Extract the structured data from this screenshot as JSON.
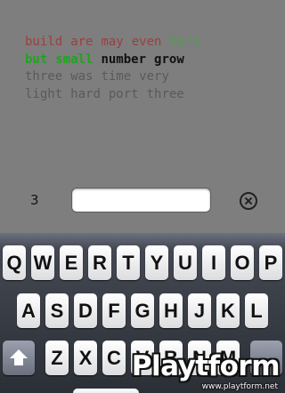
{
  "words": {
    "line1": [
      {
        "text": "build",
        "state": "done"
      },
      {
        "text": "are",
        "state": "done"
      },
      {
        "text": "may",
        "state": "done"
      },
      {
        "text": "even",
        "state": "done"
      },
      {
        "text": "turn",
        "state": "next"
      }
    ],
    "line2": [
      {
        "text": "but",
        "state": "active"
      },
      {
        "text": "small",
        "state": "active"
      },
      {
        "text": "number",
        "state": "queued"
      },
      {
        "text": "grow",
        "state": "queued"
      }
    ],
    "line3": [
      {
        "text": "three",
        "state": "future"
      },
      {
        "text": "was",
        "state": "future"
      },
      {
        "text": "time",
        "state": "future"
      },
      {
        "text": "very",
        "state": "future"
      }
    ],
    "line4": [
      {
        "text": "light",
        "state": "future"
      },
      {
        "text": "hard",
        "state": "future"
      },
      {
        "text": "port",
        "state": "future"
      },
      {
        "text": "three",
        "state": "future"
      }
    ]
  },
  "input_bar": {
    "counter": "3",
    "entry_value": "",
    "clear_icon": "clear-circle-icon"
  },
  "keyboard": {
    "row1": [
      "Q",
      "W",
      "E",
      "R",
      "T",
      "Y",
      "U",
      "I",
      "O",
      "P"
    ],
    "row2": [
      "A",
      "S",
      "D",
      "F",
      "G",
      "H",
      "J",
      "K",
      "L"
    ],
    "row3": [
      "Z",
      "X",
      "C",
      "V",
      "B",
      "N",
      "M"
    ],
    "shift_icon": "shift-arrow-icon"
  },
  "watermark": {
    "logo": "Playtform",
    "url": "www.playtform.net"
  },
  "colors": {
    "background": "#7e7e7e",
    "word_done": "#9b3f3f",
    "word_next": "#4f9d4f",
    "word_active": "#1ea51e",
    "word_queued": "#111111",
    "word_future": "#5a5a5a"
  }
}
